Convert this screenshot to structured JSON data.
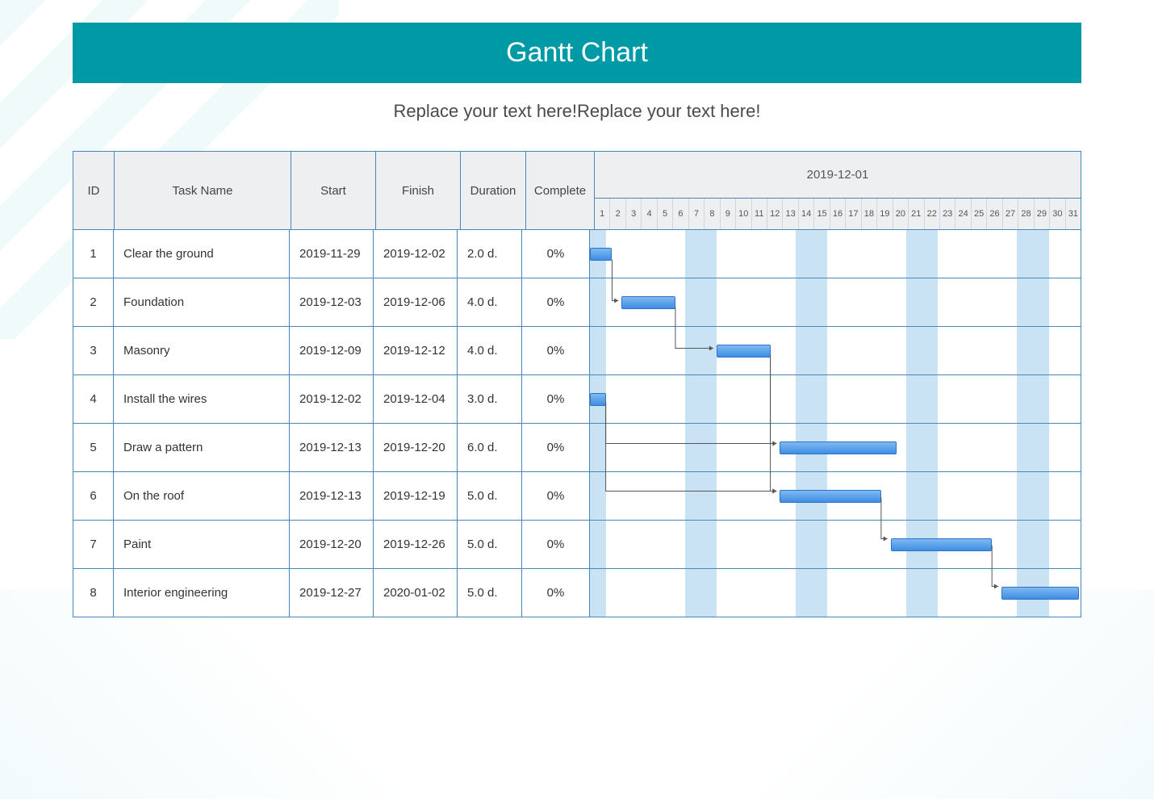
{
  "title": "Gantt Chart",
  "subtitle": "Replace your text here!Replace your text here!",
  "colors": {
    "header_bg": "#009aa6",
    "bar_from": "#7fb8f2",
    "bar_to": "#3f8ee3",
    "grid": "#4a87b8"
  },
  "columns": {
    "id": "ID",
    "name": "Task Name",
    "start": "Start",
    "finish": "Finish",
    "duration": "Duration",
    "complete": "Complete"
  },
  "timeline": {
    "label": "2019-12-01",
    "days": [
      "1",
      "2",
      "3",
      "4",
      "5",
      "6",
      "7",
      "8",
      "9",
      "10",
      "11",
      "12",
      "13",
      "14",
      "15",
      "16",
      "17",
      "18",
      "19",
      "20",
      "21",
      "22",
      "23",
      "24",
      "25",
      "26",
      "27",
      "28",
      "29",
      "30",
      "31"
    ],
    "shaded_day_ranges": [
      [
        1,
        1
      ],
      [
        7,
        8
      ],
      [
        14,
        15
      ],
      [
        21,
        22
      ],
      [
        28,
        29
      ]
    ]
  },
  "tasks": [
    {
      "id": "1",
      "name": "Clear the ground",
      "start": "2019-11-29",
      "finish": "2019-12-02",
      "duration": "2.0 d.",
      "complete": "0%",
      "bar_start_day": 1,
      "bar_end_day": 2.4
    },
    {
      "id": "2",
      "name": "Foundation",
      "start": "2019-12-03",
      "finish": "2019-12-06",
      "duration": "4.0 d.",
      "complete": "0%",
      "bar_start_day": 3,
      "bar_end_day": 6.4
    },
    {
      "id": "3",
      "name": "Masonry",
      "start": "2019-12-09",
      "finish": "2019-12-12",
      "duration": "4.0 d.",
      "complete": "0%",
      "bar_start_day": 9,
      "bar_end_day": 12.4
    },
    {
      "id": "4",
      "name": "Install the wires",
      "start": "2019-12-02",
      "finish": "2019-12-04",
      "duration": "3.0 d.",
      "complete": "0%",
      "bar_start_day": 1,
      "bar_end_day": 2.0
    },
    {
      "id": "5",
      "name": "Draw a pattern",
      "start": "2019-12-13",
      "finish": "2019-12-20",
      "duration": "6.0 d.",
      "complete": "0%",
      "bar_start_day": 13,
      "bar_end_day": 20.4
    },
    {
      "id": "6",
      "name": "On the roof",
      "start": "2019-12-13",
      "finish": "2019-12-19",
      "duration": "5.0 d.",
      "complete": "0%",
      "bar_start_day": 13,
      "bar_end_day": 19.4
    },
    {
      "id": "7",
      "name": "Paint",
      "start": "2019-12-20",
      "finish": "2019-12-26",
      "duration": "5.0 d.",
      "complete": "0%",
      "bar_start_day": 20,
      "bar_end_day": 26.4
    },
    {
      "id": "8",
      "name": "Interior engineering",
      "start": "2019-12-27",
      "finish": "2020-01-02",
      "duration": "5.0 d.",
      "complete": "0%",
      "bar_start_day": 27,
      "bar_end_day": 31.9
    }
  ],
  "dependencies": [
    {
      "from": 1,
      "to": 2
    },
    {
      "from": 2,
      "to": 3
    },
    {
      "from": 3,
      "to": 5
    },
    {
      "from": 4,
      "to": 5
    },
    {
      "from": 3,
      "to": 6
    },
    {
      "from": 4,
      "to": 6
    },
    {
      "from": 6,
      "to": 7
    },
    {
      "from": 7,
      "to": 8
    }
  ],
  "chart_data": {
    "type": "gantt",
    "title": "Gantt Chart",
    "x_axis": "2019-12-01 to 2019-12-31 (days 1–31)",
    "tasks": [
      {
        "id": 1,
        "name": "Clear the ground",
        "start": "2019-11-29",
        "finish": "2019-12-02",
        "duration_days": 2.0,
        "complete_pct": 0
      },
      {
        "id": 2,
        "name": "Foundation",
        "start": "2019-12-03",
        "finish": "2019-12-06",
        "duration_days": 4.0,
        "complete_pct": 0
      },
      {
        "id": 3,
        "name": "Masonry",
        "start": "2019-12-09",
        "finish": "2019-12-12",
        "duration_days": 4.0,
        "complete_pct": 0
      },
      {
        "id": 4,
        "name": "Install the wires",
        "start": "2019-12-02",
        "finish": "2019-12-04",
        "duration_days": 3.0,
        "complete_pct": 0
      },
      {
        "id": 5,
        "name": "Draw a pattern",
        "start": "2019-12-13",
        "finish": "2019-12-20",
        "duration_days": 6.0,
        "complete_pct": 0
      },
      {
        "id": 6,
        "name": "On the roof",
        "start": "2019-12-13",
        "finish": "2019-12-19",
        "duration_days": 5.0,
        "complete_pct": 0
      },
      {
        "id": 7,
        "name": "Paint",
        "start": "2019-12-20",
        "finish": "2019-12-26",
        "duration_days": 5.0,
        "complete_pct": 0
      },
      {
        "id": 8,
        "name": "Interior engineering",
        "start": "2019-12-27",
        "finish": "2020-01-02",
        "duration_days": 5.0,
        "complete_pct": 0
      }
    ],
    "dependencies": [
      [
        1,
        2
      ],
      [
        2,
        3
      ],
      [
        3,
        5
      ],
      [
        4,
        5
      ],
      [
        3,
        6
      ],
      [
        4,
        6
      ],
      [
        6,
        7
      ],
      [
        7,
        8
      ]
    ],
    "weekend_shaded_days_of_december": [
      1,
      7,
      8,
      14,
      15,
      21,
      22,
      28,
      29
    ]
  }
}
